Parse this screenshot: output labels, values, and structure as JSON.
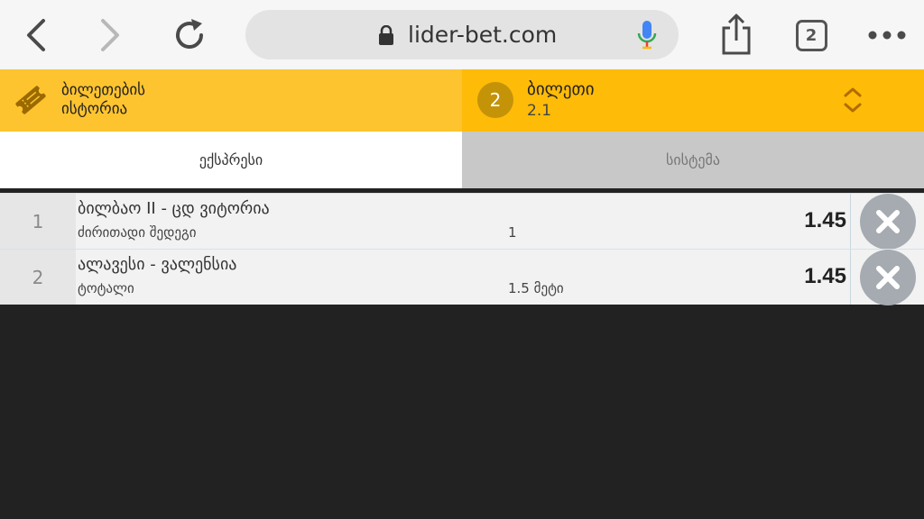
{
  "browser": {
    "url": "lider-bet.com",
    "tab_count": "2",
    "icons": {
      "back": "chevron-left-icon",
      "forward": "chevron-right-icon",
      "reload": "reload-icon",
      "lock": "lock-icon",
      "mic": "microphone-icon",
      "share": "share-icon",
      "tabs": "tabs-icon",
      "more": "more-icon"
    }
  },
  "header": {
    "history_line1": "ბილეთების",
    "history_line2": "ისტორია",
    "ticket_count": "2",
    "ticket_title": "ბილეთი",
    "ticket_odds": "2.1",
    "colors": {
      "left": "#fec42f",
      "right": "#febb08",
      "badge": "#c49308"
    }
  },
  "tabs": {
    "express": "ექსპრესი",
    "system": "სისტემა"
  },
  "bets": [
    {
      "num": "1",
      "match": "ბილბაო II - ცდ ვიტორია",
      "market": "ძირითადი შედეგი",
      "pick": "1",
      "odds": "1.45"
    },
    {
      "num": "2",
      "match": "ალავესი - ვალენსია",
      "market": "ტოტალი",
      "pick": "1.5 მეტი",
      "odds": "1.45"
    }
  ]
}
